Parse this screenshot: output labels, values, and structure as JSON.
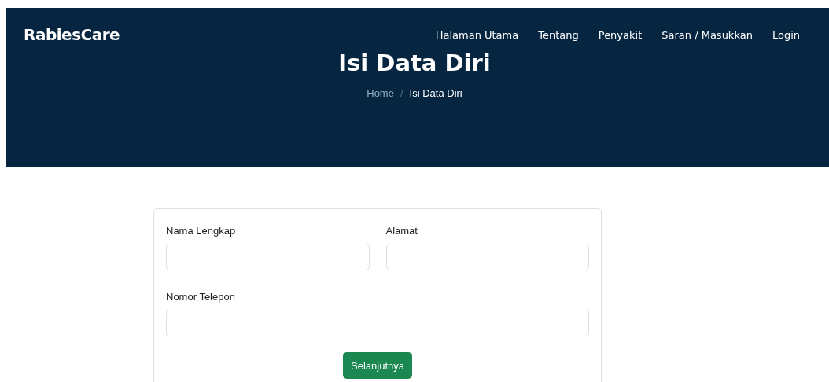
{
  "brand": "RabiesCare",
  "nav": [
    {
      "label": "Halaman Utama"
    },
    {
      "label": "Tentang"
    },
    {
      "label": "Penyakit"
    },
    {
      "label": "Saran / Masukkan"
    },
    {
      "label": "Login"
    }
  ],
  "hero": {
    "title": "Isi Data Diri",
    "breadcrumb": [
      "Home",
      "Isi Data Diri"
    ],
    "separator": "/"
  },
  "form": {
    "fields": [
      {
        "label": "Nama Lengkap",
        "wide": false
      },
      {
        "label": "Alamat",
        "wide": false
      },
      {
        "label": "Nomor Telepon",
        "wide": true
      }
    ],
    "submit": "Selanjutnya"
  }
}
